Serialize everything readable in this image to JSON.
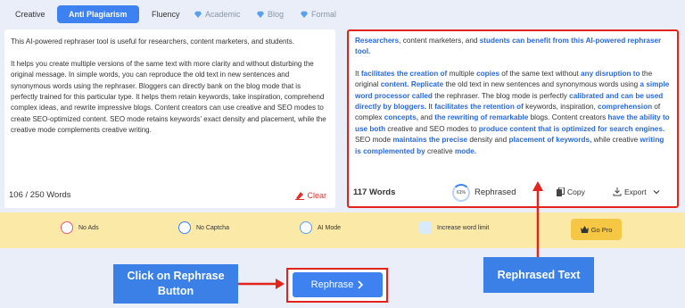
{
  "tabs": [
    {
      "label": "Creative"
    },
    {
      "label": "Anti Plagiarism"
    },
    {
      "label": "Fluency"
    },
    {
      "label": "Academic"
    },
    {
      "label": "Blog"
    },
    {
      "label": "Formal"
    }
  ],
  "input": {
    "text": "This AI-powered rephraser tool is useful for researchers, content marketers, and students.\n\nIt helps you create multiple versions of the same text with more clarity and without disturbing the original message. In simple words, you can reproduce the old text in new sentences and synonymous words using the rephraser. Bloggers can directly bank on the blog mode that is perfectly trained for this particular type. It helps them retain keywords, take inspiration, comprehend complex ideas, and rewrite impressive blogs. Content creators can use creative and SEO modes to create SEO-optimized content. SEO mode retains keywords' exact density and placement, while the creative mode complements creative writing.",
    "word_count": "106 / 250 Words",
    "clear_label": "Clear"
  },
  "output": {
    "p1": [
      {
        "t": "Researchers",
        "h": true
      },
      {
        "t": ", content marketers, and ",
        "h": false
      },
      {
        "t": "students can benefit from this AI-powered rephraser tool.",
        "h": true
      }
    ],
    "p2": [
      {
        "t": "It ",
        "h": false
      },
      {
        "t": "facilitates the creation of",
        "h": true
      },
      {
        "t": " multiple ",
        "h": false
      },
      {
        "t": "copies",
        "h": true
      },
      {
        "t": " of the same text without ",
        "h": false
      },
      {
        "t": "any disruption to",
        "h": true
      },
      {
        "t": " the original ",
        "h": false
      },
      {
        "t": "content.",
        "h": true
      },
      {
        "t": "  ",
        "h": false
      },
      {
        "t": "Replicate",
        "h": true
      },
      {
        "t": " the old text in new sentences and synonymous words using ",
        "h": false
      },
      {
        "t": "a simple word processor called",
        "h": true
      },
      {
        "t": " the rephraser.  The blog mode is perfectly ",
        "h": false
      },
      {
        "t": "calibrated and can be used directly by bloggers.",
        "h": true
      },
      {
        "t": "  It ",
        "h": false
      },
      {
        "t": "facilitates the retention of",
        "h": true
      },
      {
        "t": " keywords, inspiration, ",
        "h": false
      },
      {
        "t": "comprehension",
        "h": true
      },
      {
        "t": " of complex ",
        "h": false
      },
      {
        "t": "concepts,",
        "h": true
      },
      {
        "t": " and ",
        "h": false
      },
      {
        "t": "the rewriting of remarkable",
        "h": true
      },
      {
        "t": " blogs.  Content creators ",
        "h": false
      },
      {
        "t": "have the ability to use",
        "h": true
      },
      {
        "t": " ",
        "h": false
      },
      {
        "t": "both",
        "h": true
      },
      {
        "t": " creative and SEO modes to ",
        "h": false
      },
      {
        "t": "produce content that is optimized for search engines.",
        "h": true
      },
      {
        "t": "  SEO mode ",
        "h": false
      },
      {
        "t": "maintains the precise",
        "h": true
      },
      {
        "t": " density and ",
        "h": false
      },
      {
        "t": "placement of keywords,",
        "h": true
      },
      {
        "t": " while creative ",
        "h": false
      },
      {
        "t": "writing is complemented by",
        "h": true
      },
      {
        "t": " creative ",
        "h": false
      },
      {
        "t": "mode.",
        "h": true
      }
    ],
    "word_count": "117 Words",
    "percent": "61%",
    "rephrased_label": "Rephrased",
    "copy_label": "Copy",
    "export_label": "Export"
  },
  "features": [
    {
      "label": "No Ads"
    },
    {
      "label": "No Captcha"
    },
    {
      "label": "AI Mode"
    },
    {
      "label": "Increase word limit"
    }
  ],
  "go_pro_label": "Go Pro",
  "rephrase_label": "Rephrase",
  "annotations": {
    "left": "Click on Rephrase Button",
    "right": "Rephrased Text"
  },
  "colors": {
    "accent": "#3d82f0",
    "highlight": "#2a6ad8",
    "annotation_red": "#e3231c",
    "features_bg": "#fbe9a8"
  }
}
